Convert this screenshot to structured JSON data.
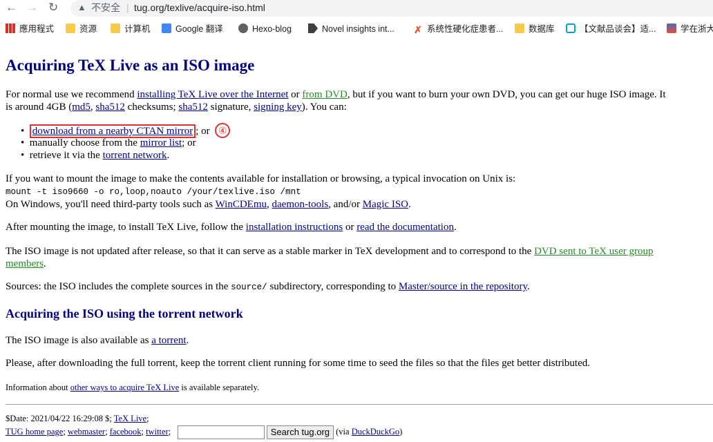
{
  "browser": {
    "back": "←",
    "forward": "→",
    "reload": "↻",
    "insecure_label": "不安全",
    "url": "tug.org/texlive/acquire-iso.html",
    "bookmarks": [
      "應用程式",
      "资源",
      "计算机",
      "Google 翻译",
      "Hexo-blog",
      "Novel insights int...",
      "系统性硬化症患者...",
      "数据库",
      "【文献品谈会】适...",
      "学在浙大"
    ]
  },
  "page": {
    "title": "Acquiring TeX Live as an ISO image",
    "intro": {
      "t1": "For normal use we recommend ",
      "l1": "installing TeX Live over the Internet",
      "t2": " or ",
      "l2": "from DVD",
      "t3": ", but if you want to burn your own DVD, you can get our huge ISO image. It",
      "t4": "is around 4GB (",
      "l3": "md5",
      "t5": ", ",
      "l4": "sha512",
      "t6": " checksums; ",
      "l5": "sha512",
      "t7": " signature, ",
      "l6": "signing key",
      "t8": "). You can:"
    },
    "list": {
      "i1_link": "download from a nearby CTAN mirror",
      "i1_after": "; or",
      "marker": "④",
      "i2_text": "manually choose from the ",
      "i2_link": "mirror list",
      "i2_after": "; or",
      "i3_text": "retrieve it via the ",
      "i3_link": "torrent network",
      "i3_after": "."
    },
    "mount": {
      "t1": "If you want to mount the image to make the contents available for installation or browsing, a typical invocation on Unix is:",
      "cmd": "mount -t iso9660 -o ro,loop,noauto /your/texlive.iso /mnt",
      "t2": "On Windows, you'll need third-party tools such as ",
      "l1": "WinCDEmu",
      "t3": ", ",
      "l2": "daemon-tools",
      "t4": ", and/or ",
      "l3": "Magic ISO",
      "t5": "."
    },
    "after": {
      "t1": "After mounting the image, to install TeX Live, follow the ",
      "l1": "installation instructions",
      "t2": " or ",
      "l2": "read the documentation",
      "t3": "."
    },
    "iso": {
      "t1": "The ISO image is not updated after release, so that it can serve as a stable marker in TeX development and to correspond to the ",
      "l1a": "DVD sent to TeX user group",
      "l1b": "members",
      "t2": "."
    },
    "sources": {
      "t1": "Sources: the ISO includes the complete sources in the ",
      "code": "source/",
      "t2": " subdirectory, corresponding to ",
      "l1": "Master/source in the repository",
      "t3": "."
    },
    "h2": "Acquiring the ISO using the torrent network",
    "torrent": {
      "t1": "The ISO image is also available as ",
      "l1": "a torrent",
      "t2": "."
    },
    "seed": "Please, after downloading the full torrent, keep the torrent client running for some time to seed the files so that the files get better distributed.",
    "info": {
      "t1": "Information about ",
      "l1": "other ways to acquire TeX Live",
      "t2": " is available separately."
    },
    "footer": {
      "date": "$Date: 2021/04/22 16:29:08 $; ",
      "texlive": "TeX Live",
      "semi": ";",
      "home": "TUG home page",
      "webmaster": "webmaster",
      "facebook": "facebook",
      "twitter": "twitter",
      "search_btn": "Search tug.org",
      "via": "(via ",
      "ddg": "DuckDuckGo",
      "close": ")"
    }
  }
}
